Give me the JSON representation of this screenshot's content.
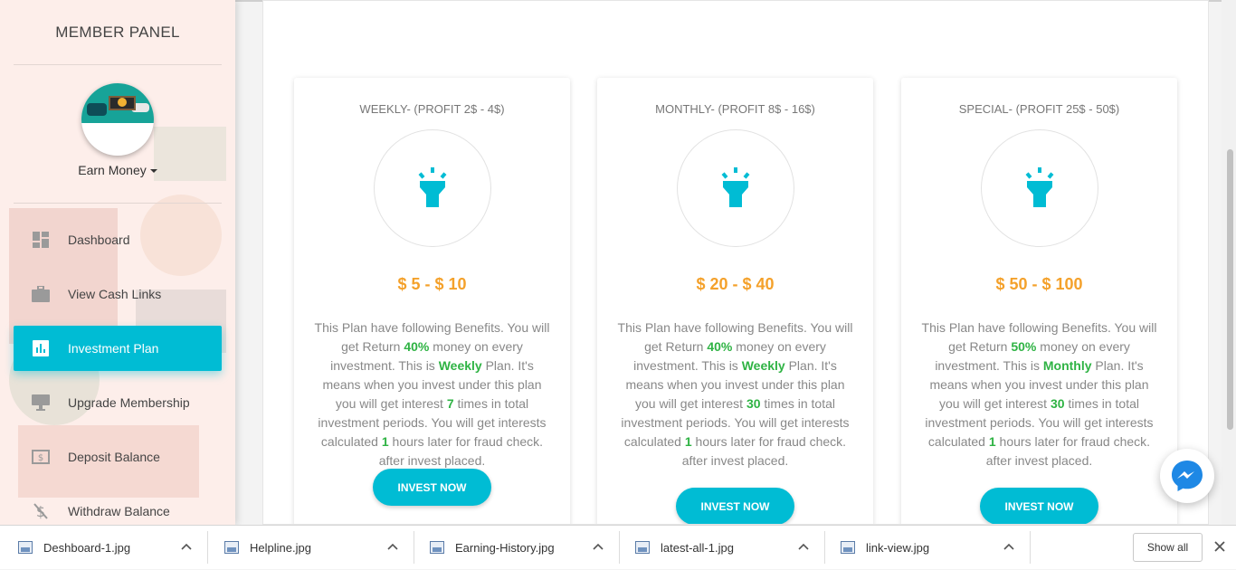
{
  "sidebar": {
    "title": "MEMBER PANEL",
    "user": {
      "name": "Earn Money"
    },
    "items": [
      {
        "label": "Dashboard",
        "icon": "dashboard-icon",
        "active": false
      },
      {
        "label": "View Cash Links",
        "icon": "briefcase-icon",
        "active": false
      },
      {
        "label": "Investment Plan",
        "icon": "chart-icon",
        "active": true
      },
      {
        "label": "Upgrade Membership",
        "icon": "monitor-icon",
        "active": false
      },
      {
        "label": "Deposit Balance",
        "icon": "cash-icon",
        "active": false
      },
      {
        "label": "Withdraw Balance",
        "icon": "money-off-icon",
        "active": false
      }
    ]
  },
  "plans": [
    {
      "title": "WEEKLY- (PROFIT 2$ - 4$)",
      "price": "$ 5 - $ 10",
      "desc": {
        "p1": "This Plan have following Benefits. You will get Return ",
        "return": "40%",
        "p2": " money on every investment. This is ",
        "type": "Weekly",
        "p3": " Plan. It's means when you invest under this plan you will get interest ",
        "times": "7",
        "p4": " times in total investment periods. You will get interests calculated ",
        "hours": "1",
        "p5": " hours later for fraud check. after invest placed."
      },
      "button": "INVEST NOW"
    },
    {
      "title": "MONTHLY- (PROFIT 8$ - 16$)",
      "price": "$ 20 - $ 40",
      "desc": {
        "p1": "This Plan have following Benefits. You will get Return ",
        "return": "40%",
        "p2": " money on every investment. This is ",
        "type": "Weekly",
        "p3": " Plan. It's means when you invest under this plan you will get interest ",
        "times": "30",
        "p4": " times in total investment periods. You will get interests calculated ",
        "hours": "1",
        "p5": " hours later for fraud check. after invest placed."
      },
      "button": "INVEST NOW"
    },
    {
      "title": "SPECIAL- (PROFIT 25$ - 50$)",
      "price": "$ 50 - $ 100",
      "desc": {
        "p1": "This Plan have following Benefits. You will get Return ",
        "return": "50%",
        "p2": " money on every investment. This is ",
        "type": "Monthly",
        "p3": " Plan. It's means when you invest under this plan you will get interest ",
        "times": "30",
        "p4": " times in total investment periods. You will get interests calculated ",
        "hours": "1",
        "p5": " hours later for fraud check. after invest placed."
      },
      "button": "INVEST NOW"
    }
  ],
  "downloads": {
    "files": [
      "Deshboard-1.jpg",
      "Helpline.jpg",
      "Earning-History.jpg",
      "latest-all-1.jpg",
      "link-view.jpg"
    ],
    "show_all": "Show all"
  },
  "colors": {
    "accent": "#00bcd4",
    "price": "#f4a12b",
    "highlight": "#2fb344"
  }
}
